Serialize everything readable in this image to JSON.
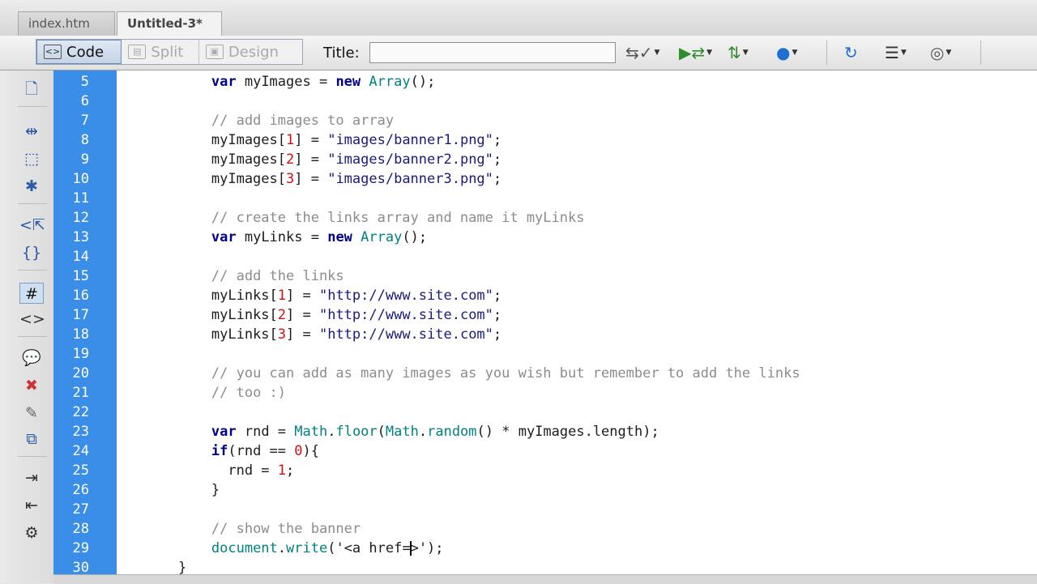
{
  "tabs": [
    {
      "label": "index.htm",
      "active": false
    },
    {
      "label": "Untitled-3*",
      "active": true
    }
  ],
  "toolbar": {
    "views": [
      {
        "label": "Code",
        "icon": "code-view-icon",
        "active": true
      },
      {
        "label": "Split",
        "icon": "split-view-icon",
        "active": false
      },
      {
        "label": "Design",
        "icon": "design-view-icon",
        "active": false
      }
    ],
    "title_label": "Title:",
    "title_value": "",
    "icons": [
      "file-management-icon",
      "preview-icon",
      "file-transfer-icon",
      "browser-check-icon",
      "refresh-icon",
      "view-options-icon",
      "visual-aids-icon"
    ]
  },
  "rail_icons": [
    "open-documents-icon",
    "collapse-tag-icon",
    "collapse-selection-icon",
    "expand-all-icon",
    "select-parent-tag-icon",
    "balance-braces-icon",
    "line-numbers-icon",
    "highlight-invalid-code-icon",
    "apply-comment-icon",
    "remove-comment-icon",
    "wrap-tag-icon",
    "recent-snippets-icon",
    "indent-code-icon",
    "outdent-code-icon",
    "format-source-icon"
  ],
  "colors": {
    "gutter": "#3a8ee8",
    "keyword": "#00008b",
    "comment": "#8c8c8c",
    "number": "#d01010",
    "object": "#008080"
  },
  "code": {
    "lines": [
      {
        "n": "5",
        "tokens": [
          {
            "t": "        "
          },
          {
            "t": "var",
            "c": "kw"
          },
          {
            "t": " myImages = "
          },
          {
            "t": "new",
            "c": "kw"
          },
          {
            "t": " "
          },
          {
            "t": "Array",
            "c": "ob"
          },
          {
            "t": "();"
          }
        ]
      },
      {
        "n": "6",
        "tokens": []
      },
      {
        "n": "7",
        "tokens": [
          {
            "t": "        "
          },
          {
            "t": "// add images to array",
            "c": "cm"
          }
        ]
      },
      {
        "n": "8",
        "tokens": [
          {
            "t": "        myImages["
          },
          {
            "t": "1",
            "c": "nm"
          },
          {
            "t": "] = "
          },
          {
            "t": "\"images/banner1.png\"",
            "c": "st"
          },
          {
            "t": ";"
          }
        ]
      },
      {
        "n": "9",
        "tokens": [
          {
            "t": "        myImages["
          },
          {
            "t": "2",
            "c": "nm"
          },
          {
            "t": "] = "
          },
          {
            "t": "\"images/banner2.png\"",
            "c": "st"
          },
          {
            "t": ";"
          }
        ]
      },
      {
        "n": "10",
        "tokens": [
          {
            "t": "        myImages["
          },
          {
            "t": "3",
            "c": "nm"
          },
          {
            "t": "] = "
          },
          {
            "t": "\"images/banner3.png\"",
            "c": "st"
          },
          {
            "t": ";"
          }
        ]
      },
      {
        "n": "11",
        "tokens": []
      },
      {
        "n": "12",
        "tokens": [
          {
            "t": "        "
          },
          {
            "t": "// create the links array and name it myLinks",
            "c": "cm"
          }
        ]
      },
      {
        "n": "13",
        "tokens": [
          {
            "t": "        "
          },
          {
            "t": "var",
            "c": "kw"
          },
          {
            "t": " myLinks = "
          },
          {
            "t": "new",
            "c": "kw"
          },
          {
            "t": " "
          },
          {
            "t": "Array",
            "c": "ob"
          },
          {
            "t": "();"
          }
        ]
      },
      {
        "n": "14",
        "tokens": []
      },
      {
        "n": "15",
        "tokens": [
          {
            "t": "        "
          },
          {
            "t": "// add the links",
            "c": "cm"
          }
        ]
      },
      {
        "n": "16",
        "tokens": [
          {
            "t": "        myLinks["
          },
          {
            "t": "1",
            "c": "nm"
          },
          {
            "t": "] = "
          },
          {
            "t": "\"http://www.site.com\"",
            "c": "st"
          },
          {
            "t": ";"
          }
        ]
      },
      {
        "n": "17",
        "tokens": [
          {
            "t": "        myLinks["
          },
          {
            "t": "2",
            "c": "nm"
          },
          {
            "t": "] = "
          },
          {
            "t": "\"http://www.site.com\"",
            "c": "st"
          },
          {
            "t": ";"
          }
        ]
      },
      {
        "n": "18",
        "tokens": [
          {
            "t": "        myLinks["
          },
          {
            "t": "3",
            "c": "nm"
          },
          {
            "t": "] = "
          },
          {
            "t": "\"http://www.site.com\"",
            "c": "st"
          },
          {
            "t": ";"
          }
        ]
      },
      {
        "n": "19",
        "tokens": []
      },
      {
        "n": "20",
        "tokens": [
          {
            "t": "        "
          },
          {
            "t": "// you can add as many images as you wish but remember to add the links",
            "c": "cm"
          }
        ]
      },
      {
        "n": "21",
        "tokens": [
          {
            "t": "        "
          },
          {
            "t": "// too :)",
            "c": "cm"
          }
        ]
      },
      {
        "n": "22",
        "tokens": []
      },
      {
        "n": "23",
        "tokens": [
          {
            "t": "        "
          },
          {
            "t": "var",
            "c": "kw"
          },
          {
            "t": " rnd = "
          },
          {
            "t": "Math",
            "c": "ob"
          },
          {
            "t": "."
          },
          {
            "t": "floor",
            "c": "ob"
          },
          {
            "t": "("
          },
          {
            "t": "Math",
            "c": "ob"
          },
          {
            "t": "."
          },
          {
            "t": "random",
            "c": "ob"
          },
          {
            "t": "() * myImages.length);"
          }
        ]
      },
      {
        "n": "24",
        "tokens": [
          {
            "t": "        "
          },
          {
            "t": "if",
            "c": "kw"
          },
          {
            "t": "(rnd == "
          },
          {
            "t": "0",
            "c": "nm"
          },
          {
            "t": "){"
          }
        ]
      },
      {
        "n": "25",
        "tokens": [
          {
            "t": "          rnd = "
          },
          {
            "t": "1",
            "c": "nm"
          },
          {
            "t": ";"
          }
        ]
      },
      {
        "n": "26",
        "tokens": [
          {
            "t": "        }"
          }
        ]
      },
      {
        "n": "27",
        "tokens": []
      },
      {
        "n": "28",
        "tokens": [
          {
            "t": "        "
          },
          {
            "t": "// show the banner",
            "c": "cm"
          }
        ]
      },
      {
        "n": "29",
        "tokens": [
          {
            "t": "        "
          },
          {
            "t": "document",
            "c": "ob"
          },
          {
            "t": "."
          },
          {
            "t": "write",
            "c": "ob"
          },
          {
            "t": "('<a href="
          },
          {
            "caret": true
          },
          {
            "t": ">');"
          }
        ]
      },
      {
        "n": "30",
        "tokens": [
          {
            "t": "    }"
          }
        ]
      }
    ]
  }
}
